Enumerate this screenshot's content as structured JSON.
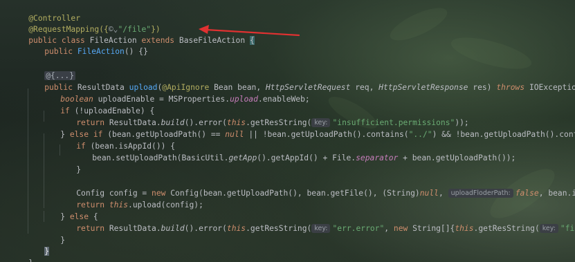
{
  "editor": {
    "lines": {
      "l1": {
        "annotation": "@Controller"
      },
      "l2": {
        "annotation": "@RequestMapping({",
        "icon_glyph": "©",
        "dropdown_glyph": "⌄",
        "path_string": "\"/file\"",
        "close": "})"
      },
      "l3": {
        "kw_public": "public",
        "kw_class": "class",
        "class_name": "FileAction",
        "kw_extends": "extends",
        "base_class": "BaseFileAction",
        "brace": "{"
      },
      "l4": {
        "kw_public": "public",
        "ctor": "FileAction",
        "rest": "() {}"
      },
      "l5": {
        "fold": "@{...}"
      },
      "l6": {
        "kw_public": "public",
        "ret": "ResultData",
        "method": "upload",
        "open": "(",
        "ann": "@ApiIgnore",
        "p1": "Bean bean,",
        "p2type": "HttpServletRequest",
        "p2": "req,",
        "p3type": "HttpServletResponse",
        "p3": "res)",
        "kw_throws": "throws",
        "exc": "IOException",
        "brace": "{"
      },
      "l7": {
        "type": "boolean",
        "var": "uploadEnable = MSProperties.",
        "field": "upload",
        "rest": ".enableWeb;"
      },
      "l8": {
        "kw": "if",
        "rest": " (!uploadEnable) {"
      },
      "l9": {
        "kw": "return",
        "cls": "ResultData.",
        "build": "build",
        "mid": "().error(",
        "this": "this",
        "call": ".getResString(",
        "hint": "key:",
        "str": "\"insufficient.permissions\"",
        "end": "));"
      },
      "l10": {
        "close": "} ",
        "kw_else": "else",
        "kw_if": " if",
        "cond1": " (bean.getUploadPath() == ",
        "null": "null",
        "cond2": " || !bean.getUploadPath().contains(",
        "s1": "\"../\"",
        "cond3": ") && !bean.getUploadPath().contains(",
        "s2": "\"..\\\\\"",
        "end": ")) {"
      },
      "l11": {
        "kw": "if",
        "rest": " (bean.isAppId()) {"
      },
      "l12": {
        "a": "bean.setUploadPath(BasicUtil.",
        "getApp": "getApp",
        "b": "().getAppId() + File.",
        "sep": "separator",
        "c": " + bean.getUploadPath());"
      },
      "l13": {
        "close": "}"
      },
      "l14": {
        "a": "Config config = ",
        "kw_new": "new",
        "b": " Config(bean.getUploadPath(), bean.getFile(), (String)",
        "null": "null",
        "c": ",",
        "hint": "uploadFloderPath:",
        "false": "false",
        "d": ", bean.isRename());"
      },
      "l15": {
        "kw": "return",
        "this": " this",
        "rest": ".upload(config);"
      },
      "l16": {
        "close": "} ",
        "kw_else": "else",
        "rest": " {"
      },
      "l17": {
        "kw": "return",
        "cls": " ResultData.",
        "build": "build",
        "mid": "().error(",
        "this": "this",
        "call": ".getResString(",
        "hint": "key:",
        "str": "\"err.error\"",
        "comma": ", ",
        "kw_new": "new",
        "arr": " String[]{",
        "this2": "this",
        "call2": ".getResString(",
        "hint2": "key:",
        "str2": "\"file.path\"",
        "end": ")});"
      },
      "l18": {
        "close": "}"
      },
      "l19": {
        "close": "}"
      },
      "l20": {
        "close": "}"
      }
    },
    "colors": {
      "keyword": "#cf8e6d",
      "string": "#6aab73",
      "annotation": "#b3ae60",
      "method": "#56a8f5",
      "static": "#c77dbb",
      "arrow": "#e03131"
    }
  }
}
